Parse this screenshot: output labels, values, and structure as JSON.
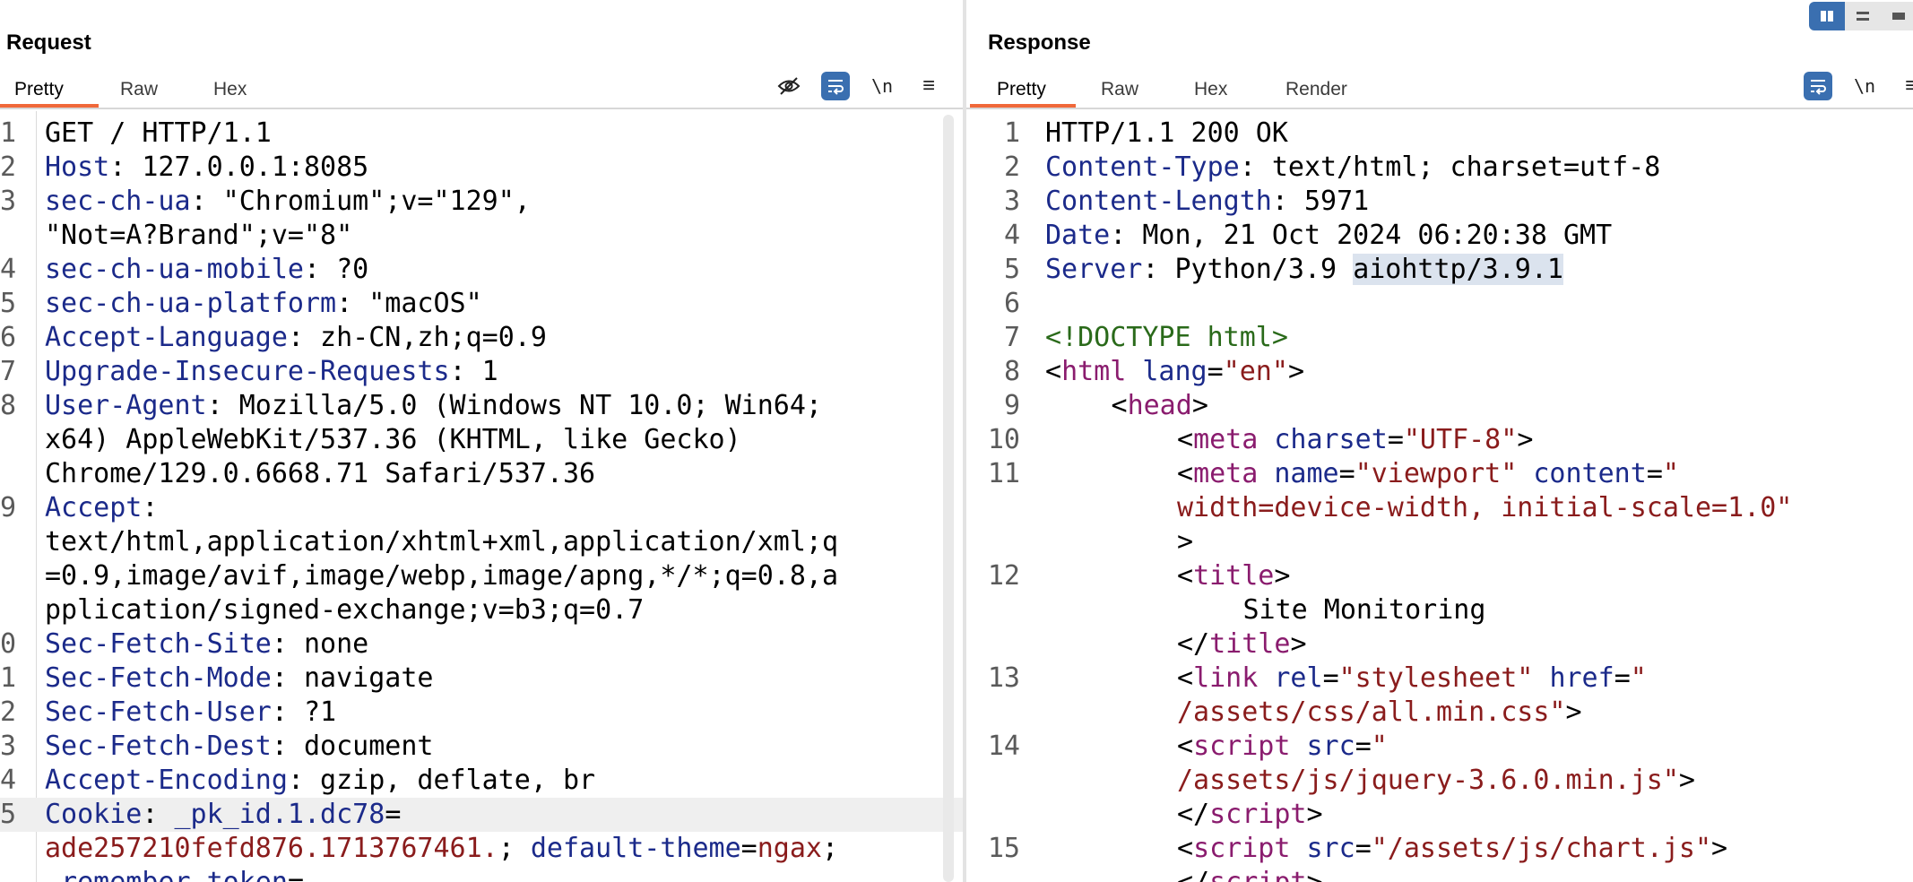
{
  "request": {
    "title": "Request",
    "tabs": [
      "Pretty",
      "Raw",
      "Hex"
    ],
    "active_tab": "Pretty",
    "toolbar": {
      "newline_label": "\\n"
    },
    "lines": [
      {
        "num": "1",
        "text": "GET / HTTP/1.1"
      },
      {
        "num": "2",
        "key": "Host",
        "val": ": 127.0.0.1:8085"
      },
      {
        "num": "3",
        "key": "sec-ch-ua",
        "val": ": \"Chromium\";v=\"129\","
      },
      {
        "num": "",
        "text": "\"Not=A?Brand\";v=\"8\""
      },
      {
        "num": "4",
        "key": "sec-ch-ua-mobile",
        "val": ": ?0"
      },
      {
        "num": "5",
        "key": "sec-ch-ua-platform",
        "val": ": \"macOS\""
      },
      {
        "num": "6",
        "key": "Accept-Language",
        "val": ": zh-CN,zh;q=0.9"
      },
      {
        "num": "7",
        "key": "Upgrade-Insecure-Requests",
        "val": ": 1"
      },
      {
        "num": "8",
        "key": "User-Agent",
        "val": ": Mozilla/5.0 (Windows NT 10.0; Win64;"
      },
      {
        "num": "",
        "text": "x64) AppleWebKit/537.36 (KHTML, like Gecko)"
      },
      {
        "num": "",
        "text": "Chrome/129.0.6668.71 Safari/537.36"
      },
      {
        "num": "9",
        "key": "Accept",
        "val": ":"
      },
      {
        "num": "",
        "text": "text/html,application/xhtml+xml,application/xml;q"
      },
      {
        "num": "",
        "text": "=0.9,image/avif,image/webp,image/apng,*/*;q=0.8,a"
      },
      {
        "num": "",
        "text": "pplication/signed-exchange;v=b3;q=0.7"
      },
      {
        "num": "0",
        "key": "Sec-Fetch-Site",
        "val": ": none"
      },
      {
        "num": "1",
        "key": "Sec-Fetch-Mode",
        "val": ": navigate"
      },
      {
        "num": "2",
        "key": "Sec-Fetch-User",
        "val": ": ?1"
      },
      {
        "num": "3",
        "key": "Sec-Fetch-Dest",
        "val": ": document"
      },
      {
        "num": "4",
        "key": "Accept-Encoding",
        "val": ": gzip, deflate, br"
      },
      {
        "num": "5",
        "key": "Cookie",
        "val": ": ",
        "ck": "_pk_id.1.dc78",
        "eq": "=",
        "highlight": true
      },
      {
        "num": "",
        "cv": "ade257210fefd876.1713767461.",
        "rest": "; ",
        "ck2": "default-theme",
        "eq2": "=",
        "cv2": "ngax",
        "tail": ";"
      },
      {
        "num": "",
        "ck": "_remember_token",
        "eq": "="
      }
    ]
  },
  "response": {
    "title": "Response",
    "tabs": [
      "Pretty",
      "Raw",
      "Hex",
      "Render"
    ],
    "active_tab": "Pretty",
    "toolbar": {
      "newline_label": "\\n"
    },
    "lines": [
      {
        "num": "1",
        "text": "HTTP/1.1 200 OK"
      },
      {
        "num": "2",
        "key": "Content-Type",
        "val": ": text/html; charset=utf-8"
      },
      {
        "num": "3",
        "key": "Content-Length",
        "val": ": 5971"
      },
      {
        "num": "4",
        "key": "Date",
        "val": ": Mon, 21 Oct 2024 06:20:38 GMT"
      },
      {
        "num": "5",
        "key": "Server",
        "val": ": Python/3.9 ",
        "sel": "aiohttp/3.9.1"
      },
      {
        "num": "6",
        "text": ""
      },
      {
        "num": "7",
        "doctype": "<!DOCTYPE html>"
      },
      {
        "num": "8",
        "html": "<|html| |lang|=|\"en\"|>"
      },
      {
        "num": "9",
        "indent": 5,
        "html": "<|head|>"
      },
      {
        "num": "10",
        "indent": 10,
        "html": "<|meta| |charset|=|\"UTF-8\"|>"
      },
      {
        "num": "11",
        "indent": 10,
        "html": "<|meta| |name|=|\"viewport\"| |content|=|\"|"
      },
      {
        "num": "",
        "indent": 10,
        "strline": "width=device-width, initial-scale=1.0\""
      },
      {
        "num": "",
        "indent": 10,
        "text": ">"
      },
      {
        "num": "12",
        "indent": 10,
        "html": "<|title|>"
      },
      {
        "num": "",
        "indent": 15,
        "text": "Site Monitoring"
      },
      {
        "num": "",
        "indent": 10,
        "html": "</|title|>"
      },
      {
        "num": "13",
        "indent": 10,
        "html": "<|link| |rel|=|\"stylesheet\"| |href|=|\"|"
      },
      {
        "num": "",
        "indent": 10,
        "strline": "/assets/css/all.min.css\"",
        "tailtext": ">"
      },
      {
        "num": "14",
        "indent": 10,
        "html": "<|script| |src|=|\"|"
      },
      {
        "num": "",
        "indent": 10,
        "strline": "/assets/js/jquery-3.6.0.min.js\"",
        "tailtext": ">"
      },
      {
        "num": "",
        "indent": 10,
        "html": "</|script|>"
      },
      {
        "num": "15",
        "indent": 10,
        "html": "<|script| |src|=|\"/assets/js/chart.js\"|>"
      },
      {
        "num": "",
        "indent": 10,
        "html": "</|script|>"
      }
    ]
  }
}
